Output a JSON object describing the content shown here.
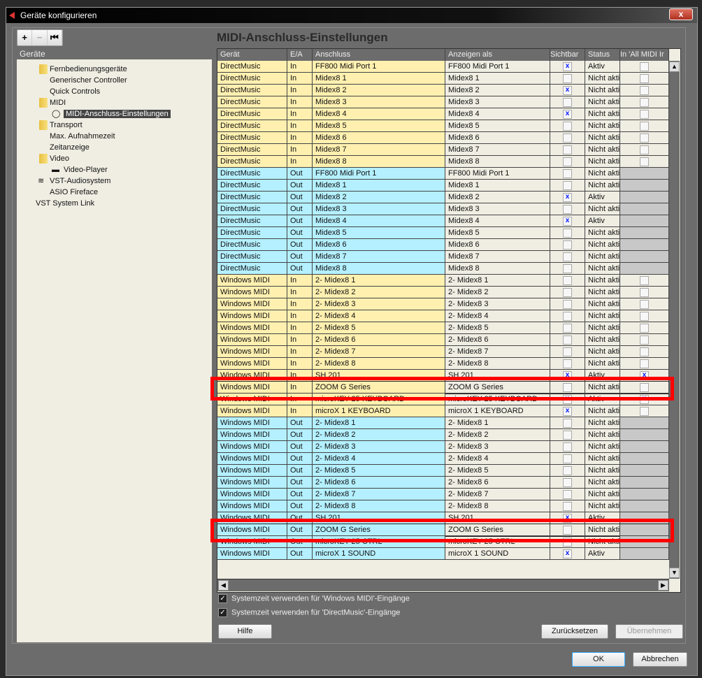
{
  "window": {
    "title": "Geräte konfigurieren",
    "close": "x"
  },
  "toolbar": {
    "add": "+",
    "remove": "−",
    "reset": "⏮"
  },
  "tree": {
    "header": "Geräte",
    "items": [
      {
        "label": "Fernbedienungsgeräte",
        "level": 0,
        "icon": "folder"
      },
      {
        "label": "Generischer Controller",
        "level": 1
      },
      {
        "label": "Quick Controls",
        "level": 1
      },
      {
        "label": "MIDI",
        "level": 0,
        "icon": "folder"
      },
      {
        "label": "MIDI-Anschluss-Einstellungen",
        "level": 1,
        "icon": "midi",
        "selected": true
      },
      {
        "label": "Transport",
        "level": 0,
        "icon": "folder"
      },
      {
        "label": "Max. Aufnahmezeit",
        "level": 1
      },
      {
        "label": "Zeitanzeige",
        "level": 1
      },
      {
        "label": "Video",
        "level": 0,
        "icon": "folder"
      },
      {
        "label": "Video-Player",
        "level": 1,
        "icon": "video"
      },
      {
        "label": "VST-Audiosystem",
        "level": 0,
        "icon": "audio"
      },
      {
        "label": "ASIO Fireface",
        "level": 1
      },
      {
        "label": "VST System Link",
        "level": 0
      }
    ]
  },
  "main": {
    "title": "MIDI-Anschluss-Einstellungen",
    "columns": [
      "Gerät",
      "E/A",
      "Anschluss",
      "Anzeigen als",
      "Sichtbar",
      "Status",
      "In 'All MIDI Ir"
    ],
    "colors": {
      "in": "#fff0b0",
      "out": "#b4f0ff",
      "highlight": "#ff0000"
    },
    "rows": [
      [
        "DirectMusic",
        "In",
        "FF800 Midi Port 1",
        "FF800 Midi Port 1",
        true,
        "Aktiv",
        false
      ],
      [
        "DirectMusic",
        "In",
        "Midex8 1",
        "Midex8 1",
        false,
        "Nicht akti",
        false
      ],
      [
        "DirectMusic",
        "In",
        "Midex8 2",
        "Midex8 2",
        true,
        "Nicht akti",
        false
      ],
      [
        "DirectMusic",
        "In",
        "Midex8 3",
        "Midex8 3",
        false,
        "Nicht akti",
        false
      ],
      [
        "DirectMusic",
        "In",
        "Midex8 4",
        "Midex8 4",
        true,
        "Nicht akti",
        false
      ],
      [
        "DirectMusic",
        "In",
        "Midex8 5",
        "Midex8 5",
        false,
        "Nicht akti",
        false
      ],
      [
        "DirectMusic",
        "In",
        "Midex8 6",
        "Midex8 6",
        false,
        "Nicht akti",
        false
      ],
      [
        "DirectMusic",
        "In",
        "Midex8 7",
        "Midex8 7",
        false,
        "Nicht akti",
        false
      ],
      [
        "DirectMusic",
        "In",
        "Midex8 8",
        "Midex8 8",
        false,
        "Nicht akti",
        false
      ],
      [
        "DirectMusic",
        "Out",
        "FF800 Midi Port 1",
        "FF800 Midi Port 1",
        false,
        "Nicht akti",
        null
      ],
      [
        "DirectMusic",
        "Out",
        "Midex8 1",
        "Midex8 1",
        false,
        "Nicht akti",
        null
      ],
      [
        "DirectMusic",
        "Out",
        "Midex8 2",
        "Midex8 2",
        true,
        "Aktiv",
        null
      ],
      [
        "DirectMusic",
        "Out",
        "Midex8 3",
        "Midex8 3",
        false,
        "Nicht akti",
        null
      ],
      [
        "DirectMusic",
        "Out",
        "Midex8 4",
        "Midex8 4",
        true,
        "Aktiv",
        null
      ],
      [
        "DirectMusic",
        "Out",
        "Midex8 5",
        "Midex8 5",
        false,
        "Nicht akti",
        null
      ],
      [
        "DirectMusic",
        "Out",
        "Midex8 6",
        "Midex8 6",
        false,
        "Nicht akti",
        null
      ],
      [
        "DirectMusic",
        "Out",
        "Midex8 7",
        "Midex8 7",
        false,
        "Nicht akti",
        null
      ],
      [
        "DirectMusic",
        "Out",
        "Midex8 8",
        "Midex8 8",
        false,
        "Nicht akti",
        null
      ],
      [
        "Windows MIDI",
        "In",
        "2- Midex8 1",
        "2- Midex8 1",
        false,
        "Nicht akti",
        false
      ],
      [
        "Windows MIDI",
        "In",
        "2- Midex8 2",
        "2- Midex8 2",
        false,
        "Nicht akti",
        false
      ],
      [
        "Windows MIDI",
        "In",
        "2- Midex8 3",
        "2- Midex8 3",
        false,
        "Nicht akti",
        false
      ],
      [
        "Windows MIDI",
        "In",
        "2- Midex8 4",
        "2- Midex8 4",
        false,
        "Nicht akti",
        false
      ],
      [
        "Windows MIDI",
        "In",
        "2- Midex8 5",
        "2- Midex8 5",
        false,
        "Nicht akti",
        false
      ],
      [
        "Windows MIDI",
        "In",
        "2- Midex8 6",
        "2- Midex8 6",
        false,
        "Nicht akti",
        false
      ],
      [
        "Windows MIDI",
        "In",
        "2- Midex8 7",
        "2- Midex8 7",
        false,
        "Nicht akti",
        false
      ],
      [
        "Windows MIDI",
        "In",
        "2- Midex8 8",
        "2- Midex8 8",
        false,
        "Nicht akti",
        false
      ],
      [
        "Windows MIDI",
        "In",
        "SH 201",
        "SH 201",
        true,
        "Aktiv",
        true
      ],
      [
        "Windows MIDI",
        "In",
        "ZOOM G Series",
        "ZOOM G Series",
        false,
        "Nicht akti",
        false
      ],
      [
        "Windows MIDI",
        "In",
        "microKEY-25 KEYBOARD",
        "microKEY-25 KEYBOARD",
        true,
        "Aktiv",
        true
      ],
      [
        "Windows MIDI",
        "In",
        "microX 1 KEYBOARD",
        "microX 1 KEYBOARD",
        true,
        "Nicht akti",
        false
      ],
      [
        "Windows MIDI",
        "Out",
        "2- Midex8 1",
        "2- Midex8 1",
        false,
        "Nicht akti",
        null
      ],
      [
        "Windows MIDI",
        "Out",
        "2- Midex8 2",
        "2- Midex8 2",
        false,
        "Nicht akti",
        null
      ],
      [
        "Windows MIDI",
        "Out",
        "2- Midex8 3",
        "2- Midex8 3",
        false,
        "Nicht akti",
        null
      ],
      [
        "Windows MIDI",
        "Out",
        "2- Midex8 4",
        "2- Midex8 4",
        false,
        "Nicht akti",
        null
      ],
      [
        "Windows MIDI",
        "Out",
        "2- Midex8 5",
        "2- Midex8 5",
        false,
        "Nicht akti",
        null
      ],
      [
        "Windows MIDI",
        "Out",
        "2- Midex8 6",
        "2- Midex8 6",
        false,
        "Nicht akti",
        null
      ],
      [
        "Windows MIDI",
        "Out",
        "2- Midex8 7",
        "2- Midex8 7",
        false,
        "Nicht akti",
        null
      ],
      [
        "Windows MIDI",
        "Out",
        "2- Midex8 8",
        "2- Midex8 8",
        false,
        "Nicht akti",
        null
      ],
      [
        "Windows MIDI",
        "Out",
        "SH 201",
        "SH 201",
        true,
        "Aktiv",
        null
      ],
      [
        "Windows MIDI",
        "Out",
        "ZOOM G Series",
        "ZOOM G Series",
        false,
        "Nicht akti",
        null
      ],
      [
        "Windows MIDI",
        "Out",
        "microKEY-25 CTRL",
        "microKEY-25 CTRL",
        false,
        "Nicht akti",
        null
      ],
      [
        "Windows MIDI",
        "Out",
        "microX 1 SOUND",
        "microX 1 SOUND",
        true,
        "Aktiv",
        null
      ]
    ],
    "highlighted_rows": [
      27,
      39
    ],
    "options": [
      {
        "label": "Systemzeit verwenden für 'Windows MIDI'-Eingänge",
        "checked": true
      },
      {
        "label": "Systemzeit verwenden für 'DirectMusic'-Eingänge",
        "checked": true
      }
    ]
  },
  "buttons": {
    "help": "Hilfe",
    "reset": "Zurücksetzen",
    "apply": "Übernehmen",
    "ok": "OK",
    "cancel": "Abbrechen"
  }
}
